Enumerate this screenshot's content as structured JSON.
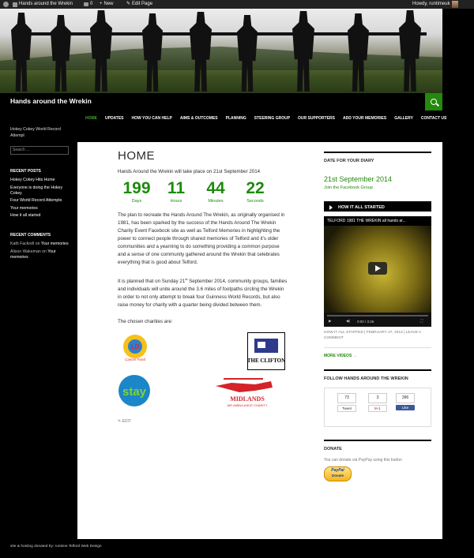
{
  "admin_bar": {
    "site_name": "Hands around the Wrekin",
    "comments_count": "0",
    "new_label": "New",
    "edit_label": "Edit Page",
    "howdy": "Howdy, runtimeuk"
  },
  "site": {
    "title": "Hands around the Wrekin",
    "nav": [
      "HOME",
      "UPDATES",
      "HOW YOU CAN HELP",
      "AIMS & OUTCOMES",
      "PLANNING",
      "STEERING GROUP",
      "OUR SUPPORTERS",
      "ADD YOUR MEMORIES",
      "GALLERY",
      "CONTACT US"
    ],
    "accent": "#24890d"
  },
  "left_sidebar": {
    "description": "Hokey Cokey World Record Attempt",
    "search_placeholder": "Search …",
    "recent_posts_title": "RECENT POSTS",
    "recent_posts": [
      "Hokey Cokey Hits Home",
      "Everyone is doing the Hokey Cokey",
      "Four World Record Attempts",
      "Your memories",
      "How it all started"
    ],
    "recent_comments_title": "RECENT COMMENTS",
    "comments": [
      {
        "author": "Kath Fackrell",
        "on": " on ",
        "post": "Your memories"
      },
      {
        "author": "Alison Wakeman",
        "on": " on ",
        "post": "Your memories"
      }
    ]
  },
  "main": {
    "title": "HOME",
    "intro": "Hands Around the Wrekin will take place on 21st September 2014",
    "countdown": [
      {
        "value": "199",
        "label": "Days"
      },
      {
        "value": "11",
        "label": "Hours"
      },
      {
        "value": "44",
        "label": "Minutes"
      },
      {
        "value": "22",
        "label": "Seconds"
      }
    ],
    "para1": "The plan to recreate the Hands Around The Wrekin, as originally organised in 1981, has been sparked by the success of the Hands Around The Wrekin Charity Event Facebook site as well as Telford Memories in highlighting the power to connect people through shared memories of Telford and it’s older communities and a yearning to do something providing a common purpose and a sense of one community gathered around the Wrekin that celebrates everything that is good about Telford.",
    "para2_a": "It is planned that on Sunday 21",
    "para2_sup": "st",
    "para2_b": " September 2014, community groups, families and individuals will unite around the 3.6 miles of footpaths circling the Wrekin in order to not only attempt to break four  Guinness World Records, but also raise money for charity with a quarter being divided between them.",
    "charities_label": "The chosen charities are:",
    "logos": {
      "ld_small": "LD",
      "ld_text": "Cancer Fund",
      "clifton": "THE CLIFTON",
      "stay": "stay",
      "midlands": "MIDLANDS",
      "midlands_sub": "AIR AMBULANCE CHARITY"
    },
    "edit": "EDIT"
  },
  "right_sidebar": {
    "diary_title": "DATE FOR YOUR DIARY",
    "date": "21st September 2014",
    "facebook_link": "Join the Facebook Group",
    "video_section_title": "HOW IT ALL STARTED",
    "video_title": "TELFORD 1981 THE WREKIN all hands ar...",
    "video_time": "0:00 / 3:26",
    "meta_a": "HOW IT ALL STARTED",
    "meta_b": " | FEBRUARY 27, 2014 | ",
    "meta_c": "LEAVE A COMMENT",
    "more_videos": "MORE VIDEOS →",
    "follow_title": "FOLLOW HANDS AROUND THE WREKIN",
    "tweet_count": "73",
    "tweet_label": "Tweet",
    "gplus_count": "3",
    "gplus_label": "8+1",
    "fb_count": "396",
    "fb_label": "Like",
    "donate_title": "DONATE",
    "donate_text": "You can donate via PayPay using this button",
    "paypal_a": "PayPal",
    "paypal_b": "Donate"
  },
  "footer": "site & hosting donated by: runtime Telford Web Design"
}
